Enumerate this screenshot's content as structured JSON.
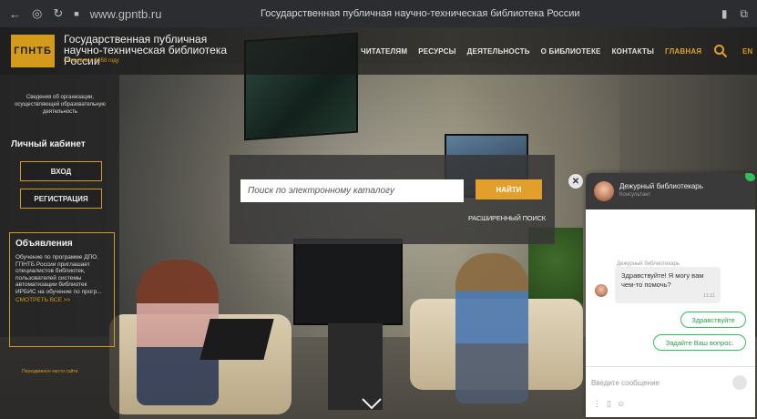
{
  "browser": {
    "url": "www.gpntb.ru",
    "tab_title": "Государственная публичная научно-техническая библиотека России",
    "icons": [
      "back-icon",
      "home-icon",
      "reload-icon",
      "lock-icon",
      "bookmark-icon",
      "extension-icon"
    ]
  },
  "header": {
    "logo_text": "ГПНТБ",
    "org_name_line1": "Государственная публичная",
    "org_name_line2": "научно-техническая библиотека России",
    "org_subtitle": "Основана в 1958 году",
    "nav": [
      "ЧИТАТЕЛЯМ",
      "РЕСУРСЫ",
      "ДЕЯТЕЛЬНОСТЬ",
      "О БИБЛИОТЕКЕ",
      "КОНТАКТЫ",
      "ГЛАВНАЯ"
    ],
    "active_nav": "ГЛАВНАЯ",
    "lang": "EN"
  },
  "sidebar": {
    "info_text": "Сведения об организации, осуществляющей образовательную деятельность",
    "cabinet_title": "Личный кабинет",
    "login_label": "ВХОД",
    "register_label": "РЕГИСТРАЦИЯ",
    "announcements_title": "Объявления",
    "announcement_text": "Обучение по программе ДПО. ГПНТБ России приглашает специалистов библиотек, пользователей системы автоматизации библиотек ИРБИС на обучение по прогр...",
    "announcement_more": "СМОТРЕТЬ ВСЕ >>",
    "footer_text": "Передвижное место сайта"
  },
  "search": {
    "placeholder": "Поиск по электронному каталогу",
    "find_label": "НАЙТИ",
    "advanced_label": "РАСШИРЕННЫЙ ПОИСК"
  },
  "chat": {
    "agent_name": "Дежурный библиотекарь",
    "agent_role": "Консультант",
    "sender_label": "Дежурный библиотекарь",
    "message_text": "Здравствуйте! Я могу вам чем-то помочь?",
    "message_time": "11:11",
    "quick_reply_1": "Здравствуйте",
    "quick_reply_2": "Задайте Ваш вопрос.",
    "input_placeholder": "Введите сообщение",
    "close_symbol": "✕"
  },
  "colors": {
    "accent": "#e2a02a",
    "online": "#2ec15b"
  }
}
